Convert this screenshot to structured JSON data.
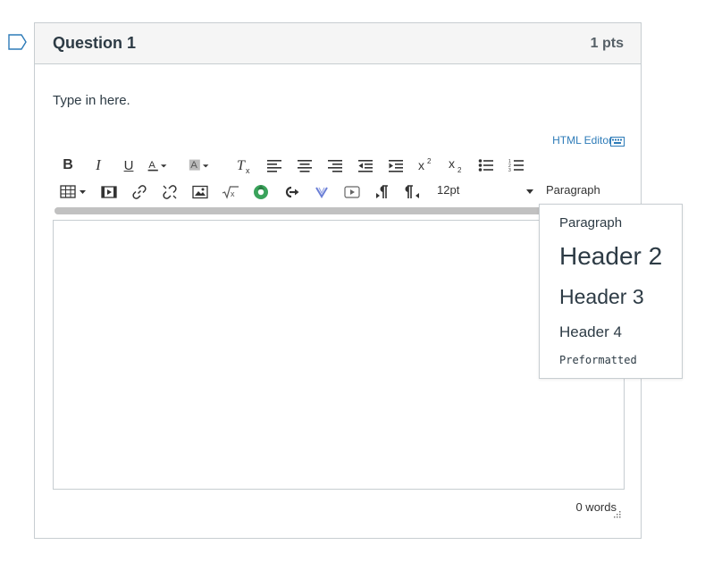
{
  "question": {
    "title": "Question 1",
    "points": "1 pts",
    "prompt": "Type in here."
  },
  "editor": {
    "html_editor_link": "HTML Editor",
    "font_size": "12pt",
    "block_format": "Paragraph",
    "word_count": "0 words"
  },
  "format_menu": {
    "items": [
      "Paragraph",
      "Header 2",
      "Header 3",
      "Header 4",
      "Preformatted"
    ]
  },
  "toolbar": {
    "row1_icons": [
      "bold-icon",
      "italic-icon",
      "underline-icon",
      "text-color-icon",
      "background-color-icon",
      "clear-formatting-icon",
      "align-left-icon",
      "align-center-icon",
      "align-right-icon",
      "outdent-icon",
      "indent-icon",
      "superscript-icon",
      "subscript-icon",
      "bulleted-list-icon",
      "numbered-list-icon"
    ],
    "row2_icons": [
      "table-icon",
      "media-icon",
      "link-icon",
      "unlink-icon",
      "image-icon",
      "equation-icon",
      "green-app-icon",
      "share-icon",
      "v-icon",
      "video-icon",
      "ltr-paragraph-icon",
      "rtl-paragraph-icon"
    ]
  },
  "colors": {
    "accent": "#2d7bb8",
    "border": "#c7cdd1",
    "header_bg": "#f5f5f5",
    "text": "#2d3b45",
    "flag": "#2d7bb8"
  }
}
